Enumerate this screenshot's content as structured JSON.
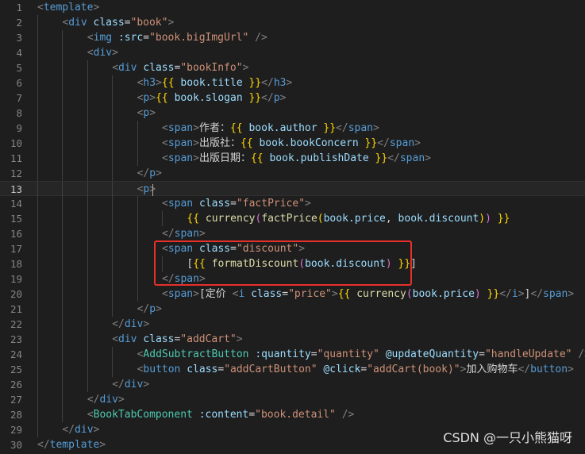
{
  "watermark": "CSDN @一只小熊猫呀",
  "colors": {
    "highlight_box": "#e8302a",
    "background": "#1e1e1e"
  },
  "lines": [
    {
      "n": "1",
      "indent": 0,
      "tokens": [
        [
          "brk",
          "<"
        ],
        [
          "tag",
          "template"
        ],
        [
          "brk",
          ">"
        ]
      ]
    },
    {
      "n": "2",
      "indent": 1,
      "tokens": [
        [
          "brk",
          "<"
        ],
        [
          "tag",
          "div"
        ],
        [
          "txt",
          " "
        ],
        [
          "attr",
          "class"
        ],
        [
          "eq",
          "="
        ],
        [
          "str",
          "\"book\""
        ],
        [
          "brk",
          ">"
        ]
      ]
    },
    {
      "n": "3",
      "indent": 2,
      "tokens": [
        [
          "brk",
          "<"
        ],
        [
          "tag",
          "img"
        ],
        [
          "txt",
          " "
        ],
        [
          "attr",
          ":src"
        ],
        [
          "eq",
          "="
        ],
        [
          "str",
          "\"book.bigImgUrl\""
        ],
        [
          "txt",
          " "
        ],
        [
          "brk",
          "/>"
        ]
      ]
    },
    {
      "n": "4",
      "indent": 2,
      "tokens": [
        [
          "brk",
          "<"
        ],
        [
          "tag",
          "div"
        ],
        [
          "brk",
          ">"
        ]
      ]
    },
    {
      "n": "5",
      "indent": 3,
      "tokens": [
        [
          "brk",
          "<"
        ],
        [
          "tag",
          "div"
        ],
        [
          "txt",
          " "
        ],
        [
          "attr",
          "class"
        ],
        [
          "eq",
          "="
        ],
        [
          "str",
          "\"bookInfo\""
        ],
        [
          "brk",
          ">"
        ]
      ]
    },
    {
      "n": "6",
      "indent": 4,
      "tokens": [
        [
          "brk",
          "<"
        ],
        [
          "tag",
          "h3"
        ],
        [
          "brk",
          ">"
        ],
        [
          "brace",
          "{{"
        ],
        [
          "txt",
          " "
        ],
        [
          "var",
          "book.title"
        ],
        [
          "txt",
          " "
        ],
        [
          "brace",
          "}}"
        ],
        [
          "brk",
          "</"
        ],
        [
          "tag",
          "h3"
        ],
        [
          "brk",
          ">"
        ]
      ]
    },
    {
      "n": "7",
      "indent": 4,
      "tokens": [
        [
          "brk",
          "<"
        ],
        [
          "tag",
          "p"
        ],
        [
          "brk",
          ">"
        ],
        [
          "brace",
          "{{"
        ],
        [
          "txt",
          " "
        ],
        [
          "var",
          "book.slogan"
        ],
        [
          "txt",
          " "
        ],
        [
          "brace",
          "}}"
        ],
        [
          "brk",
          "</"
        ],
        [
          "tag",
          "p"
        ],
        [
          "brk",
          ">"
        ]
      ]
    },
    {
      "n": "8",
      "indent": 4,
      "tokens": [
        [
          "brk",
          "<"
        ],
        [
          "tag",
          "p"
        ],
        [
          "brk",
          ">"
        ]
      ]
    },
    {
      "n": "9",
      "indent": 5,
      "tokens": [
        [
          "brk",
          "<"
        ],
        [
          "tag",
          "span"
        ],
        [
          "brk",
          ">"
        ],
        [
          "txt",
          "作者："
        ],
        [
          "brace",
          "{{"
        ],
        [
          "txt",
          " "
        ],
        [
          "var",
          "book.author"
        ],
        [
          "txt",
          " "
        ],
        [
          "brace",
          "}}"
        ],
        [
          "brk",
          "</"
        ],
        [
          "tag",
          "span"
        ],
        [
          "brk",
          ">"
        ]
      ]
    },
    {
      "n": "10",
      "indent": 5,
      "tokens": [
        [
          "brk",
          "<"
        ],
        [
          "tag",
          "span"
        ],
        [
          "brk",
          ">"
        ],
        [
          "txt",
          "出版社："
        ],
        [
          "brace",
          "{{"
        ],
        [
          "txt",
          " "
        ],
        [
          "var",
          "book.bookConcern"
        ],
        [
          "txt",
          " "
        ],
        [
          "brace",
          "}}"
        ],
        [
          "brk",
          "</"
        ],
        [
          "tag",
          "span"
        ],
        [
          "brk",
          ">"
        ]
      ]
    },
    {
      "n": "11",
      "indent": 5,
      "tokens": [
        [
          "brk",
          "<"
        ],
        [
          "tag",
          "span"
        ],
        [
          "brk",
          ">"
        ],
        [
          "txt",
          "出版日期："
        ],
        [
          "brace",
          "{{"
        ],
        [
          "txt",
          " "
        ],
        [
          "var",
          "book.publishDate"
        ],
        [
          "txt",
          " "
        ],
        [
          "brace",
          "}}"
        ],
        [
          "brk",
          "</"
        ],
        [
          "tag",
          "span"
        ],
        [
          "brk",
          ">"
        ]
      ]
    },
    {
      "n": "12",
      "indent": 4,
      "tokens": [
        [
          "brk",
          "</"
        ],
        [
          "tag",
          "p"
        ],
        [
          "brk",
          ">"
        ]
      ]
    },
    {
      "n": "13",
      "indent": 4,
      "current": true,
      "tokens": [
        [
          "brk",
          "<"
        ],
        [
          "tag",
          "p"
        ],
        [
          "brk",
          ">"
        ]
      ]
    },
    {
      "n": "14",
      "indent": 5,
      "tokens": [
        [
          "brk",
          "<"
        ],
        [
          "tag",
          "span"
        ],
        [
          "txt",
          " "
        ],
        [
          "attr",
          "class"
        ],
        [
          "eq",
          "="
        ],
        [
          "str",
          "\"factPrice\""
        ],
        [
          "brk",
          ">"
        ]
      ]
    },
    {
      "n": "15",
      "indent": 6,
      "tokens": [
        [
          "brace",
          "{{"
        ],
        [
          "txt",
          " "
        ],
        [
          "fn",
          "currency"
        ],
        [
          "paren",
          "("
        ],
        [
          "fn",
          "factPrice"
        ],
        [
          "brace",
          "("
        ],
        [
          "var",
          "book.price"
        ],
        [
          "txt",
          ", "
        ],
        [
          "var",
          "book.discount"
        ],
        [
          "brace",
          ")"
        ],
        [
          "paren",
          ")"
        ],
        [
          "txt",
          " "
        ],
        [
          "brace",
          "}}"
        ]
      ]
    },
    {
      "n": "16",
      "indent": 5,
      "tokens": [
        [
          "brk",
          "</"
        ],
        [
          "tag",
          "span"
        ],
        [
          "brk",
          ">"
        ]
      ]
    },
    {
      "n": "17",
      "indent": 5,
      "tokens": [
        [
          "brk",
          "<"
        ],
        [
          "tag",
          "span"
        ],
        [
          "txt",
          " "
        ],
        [
          "attr",
          "class"
        ],
        [
          "eq",
          "="
        ],
        [
          "str",
          "\"discount\""
        ],
        [
          "brk",
          ">"
        ]
      ]
    },
    {
      "n": "18",
      "indent": 6,
      "tokens": [
        [
          "txt",
          "["
        ],
        [
          "brace",
          "{{"
        ],
        [
          "txt",
          " "
        ],
        [
          "fn",
          "formatDiscount"
        ],
        [
          "paren",
          "("
        ],
        [
          "var",
          "book.discount"
        ],
        [
          "paren",
          ")"
        ],
        [
          "txt",
          " "
        ],
        [
          "brace",
          "}}"
        ],
        [
          "txt",
          "]"
        ]
      ]
    },
    {
      "n": "19",
      "indent": 5,
      "tokens": [
        [
          "brk",
          "</"
        ],
        [
          "tag",
          "span"
        ],
        [
          "brk",
          ">"
        ]
      ]
    },
    {
      "n": "20",
      "indent": 5,
      "tokens": [
        [
          "brk",
          "<"
        ],
        [
          "tag",
          "span"
        ],
        [
          "brk",
          ">"
        ],
        [
          "txt",
          "[定价 "
        ],
        [
          "brk",
          "<"
        ],
        [
          "tag",
          "i"
        ],
        [
          "txt",
          " "
        ],
        [
          "attr",
          "class"
        ],
        [
          "eq",
          "="
        ],
        [
          "str",
          "\"price\""
        ],
        [
          "brk",
          ">"
        ],
        [
          "brace",
          "{{"
        ],
        [
          "txt",
          " "
        ],
        [
          "fn",
          "currency"
        ],
        [
          "paren",
          "("
        ],
        [
          "var",
          "book.price"
        ],
        [
          "paren",
          ")"
        ],
        [
          "txt",
          " "
        ],
        [
          "brace",
          "}}"
        ],
        [
          "brk",
          "</"
        ],
        [
          "tag",
          "i"
        ],
        [
          "brk",
          ">"
        ],
        [
          "txt",
          "]"
        ],
        [
          "brk",
          "</"
        ],
        [
          "tag",
          "span"
        ],
        [
          "brk",
          ">"
        ]
      ]
    },
    {
      "n": "21",
      "indent": 4,
      "tokens": [
        [
          "brk",
          "</"
        ],
        [
          "tag",
          "p"
        ],
        [
          "brk",
          ">"
        ]
      ]
    },
    {
      "n": "22",
      "indent": 3,
      "tokens": [
        [
          "brk",
          "</"
        ],
        [
          "tag",
          "div"
        ],
        [
          "brk",
          ">"
        ]
      ]
    },
    {
      "n": "23",
      "indent": 3,
      "tokens": [
        [
          "brk",
          "<"
        ],
        [
          "tag",
          "div"
        ],
        [
          "txt",
          " "
        ],
        [
          "attr",
          "class"
        ],
        [
          "eq",
          "="
        ],
        [
          "str",
          "\"addCart\""
        ],
        [
          "brk",
          ">"
        ]
      ]
    },
    {
      "n": "24",
      "indent": 4,
      "tokens": [
        [
          "brk",
          "<"
        ],
        [
          "comp",
          "AddSubtractButton"
        ],
        [
          "txt",
          " "
        ],
        [
          "attr",
          ":quantity"
        ],
        [
          "eq",
          "="
        ],
        [
          "str",
          "\"quantity\""
        ],
        [
          "txt",
          " "
        ],
        [
          "attr",
          "@updateQuantity"
        ],
        [
          "eq",
          "="
        ],
        [
          "str",
          "\"handleUpdate\""
        ],
        [
          "txt",
          " "
        ],
        [
          "brk",
          "/>"
        ]
      ]
    },
    {
      "n": "25",
      "indent": 4,
      "tokens": [
        [
          "brk",
          "<"
        ],
        [
          "tag",
          "button"
        ],
        [
          "txt",
          " "
        ],
        [
          "attr",
          "class"
        ],
        [
          "eq",
          "="
        ],
        [
          "str",
          "\"addCartButton\""
        ],
        [
          "txt",
          " "
        ],
        [
          "attr",
          "@click"
        ],
        [
          "eq",
          "="
        ],
        [
          "str",
          "\"addCart(book)\""
        ],
        [
          "brk",
          ">"
        ],
        [
          "txt",
          "加入购物车"
        ],
        [
          "brk",
          "</"
        ],
        [
          "tag",
          "button"
        ],
        [
          "brk",
          ">"
        ]
      ]
    },
    {
      "n": "26",
      "indent": 3,
      "tokens": [
        [
          "brk",
          "</"
        ],
        [
          "tag",
          "div"
        ],
        [
          "brk",
          ">"
        ]
      ]
    },
    {
      "n": "27",
      "indent": 2,
      "tokens": [
        [
          "brk",
          "</"
        ],
        [
          "tag",
          "div"
        ],
        [
          "brk",
          ">"
        ]
      ]
    },
    {
      "n": "28",
      "indent": 2,
      "tokens": [
        [
          "brk",
          "<"
        ],
        [
          "comp",
          "BookTabComponent"
        ],
        [
          "txt",
          " "
        ],
        [
          "attr",
          ":content"
        ],
        [
          "eq",
          "="
        ],
        [
          "str",
          "\"book.detail\""
        ],
        [
          "txt",
          " "
        ],
        [
          "brk",
          "/>"
        ]
      ]
    },
    {
      "n": "29",
      "indent": 1,
      "tokens": [
        [
          "brk",
          "</"
        ],
        [
          "tag",
          "div"
        ],
        [
          "brk",
          ">"
        ]
      ]
    },
    {
      "n": "30",
      "indent": 0,
      "tokens": [
        [
          "brk",
          "</"
        ],
        [
          "tag",
          "template"
        ],
        [
          "brk",
          ">"
        ]
      ]
    }
  ]
}
